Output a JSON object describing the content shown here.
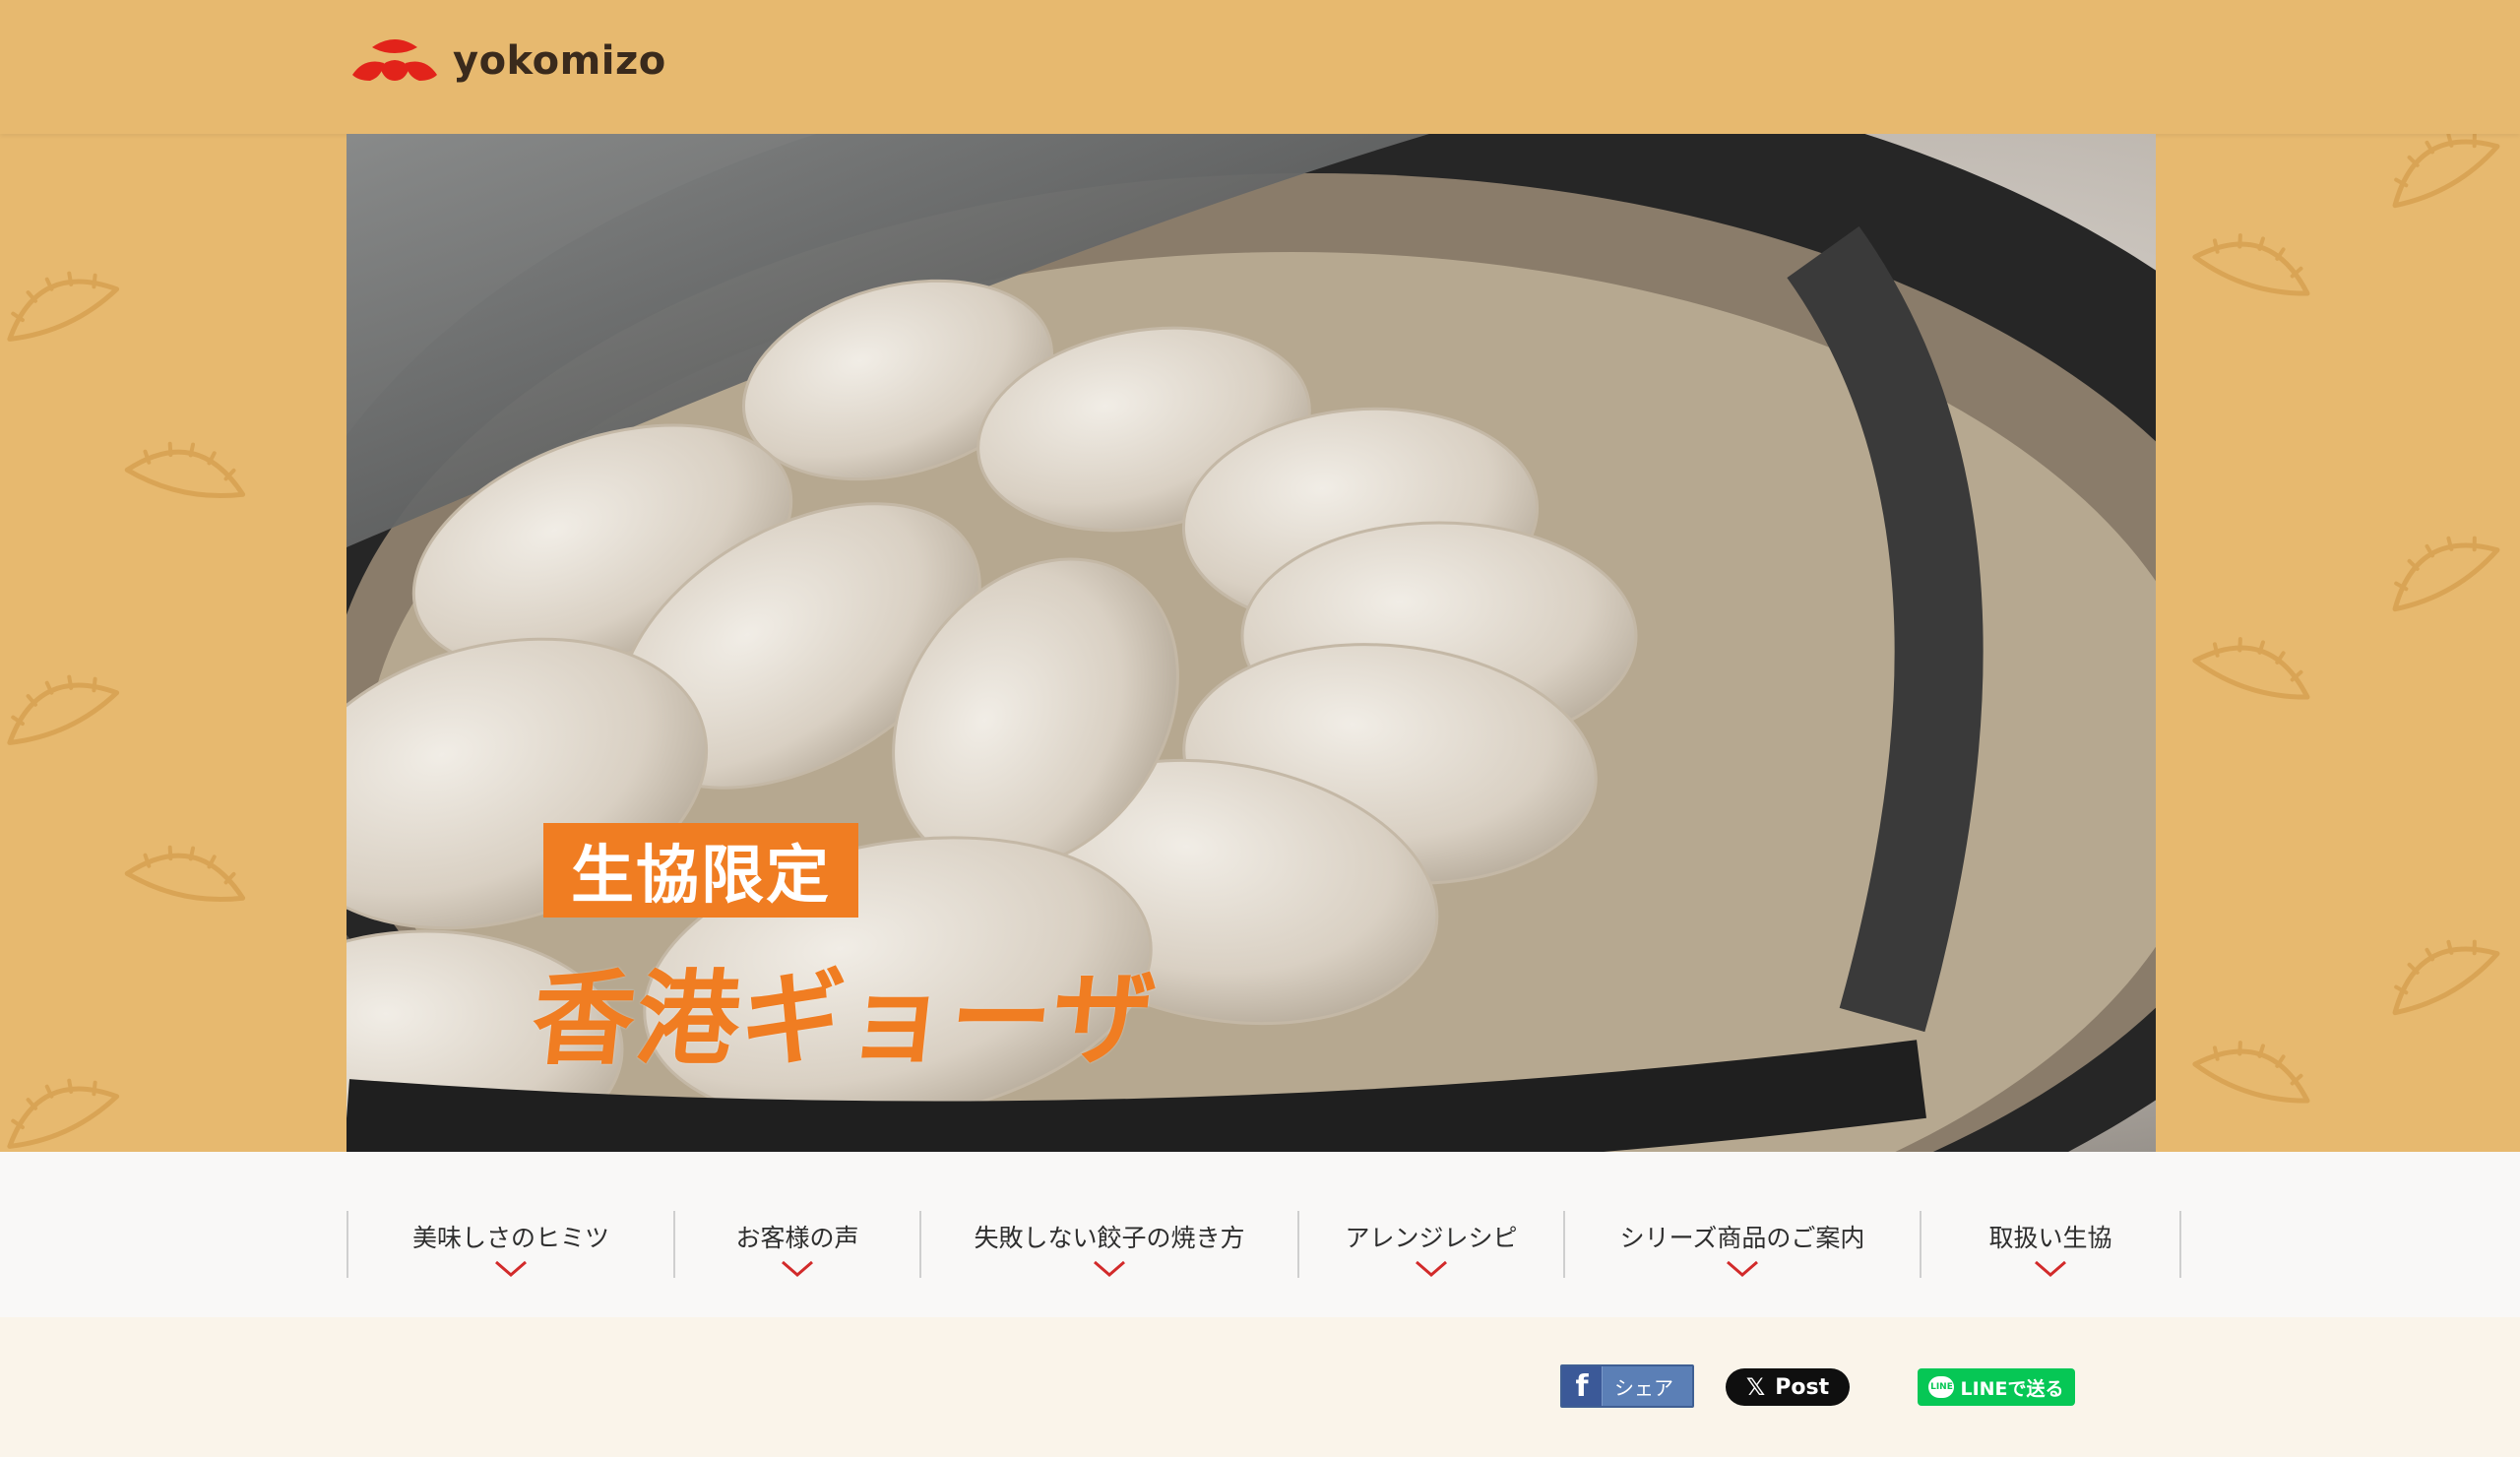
{
  "brand": {
    "name": "yokomizo"
  },
  "hero": {
    "tag": "生協限定",
    "title": "香港ギョーザ"
  },
  "nav": {
    "items": [
      {
        "label": "美味しさのヒミツ"
      },
      {
        "label": "お客様の声"
      },
      {
        "label": "失敗しない餃子の焼き方"
      },
      {
        "label": "アレンジレシピ"
      },
      {
        "label": "シリーズ商品のご案内"
      },
      {
        "label": "取扱い生協"
      }
    ]
  },
  "share": {
    "facebook": {
      "icon": "f",
      "label": "シェア"
    },
    "x": {
      "icon": "𝕏",
      "label": "Post"
    },
    "line": {
      "icon": "LINE",
      "label": "LINEで送る"
    }
  },
  "colors": {
    "background": "#e7b96f",
    "accent_orange": "#f07d22",
    "logo_red": "#e2231a",
    "chevron_red": "#d22a2a",
    "line_green": "#06c755"
  }
}
